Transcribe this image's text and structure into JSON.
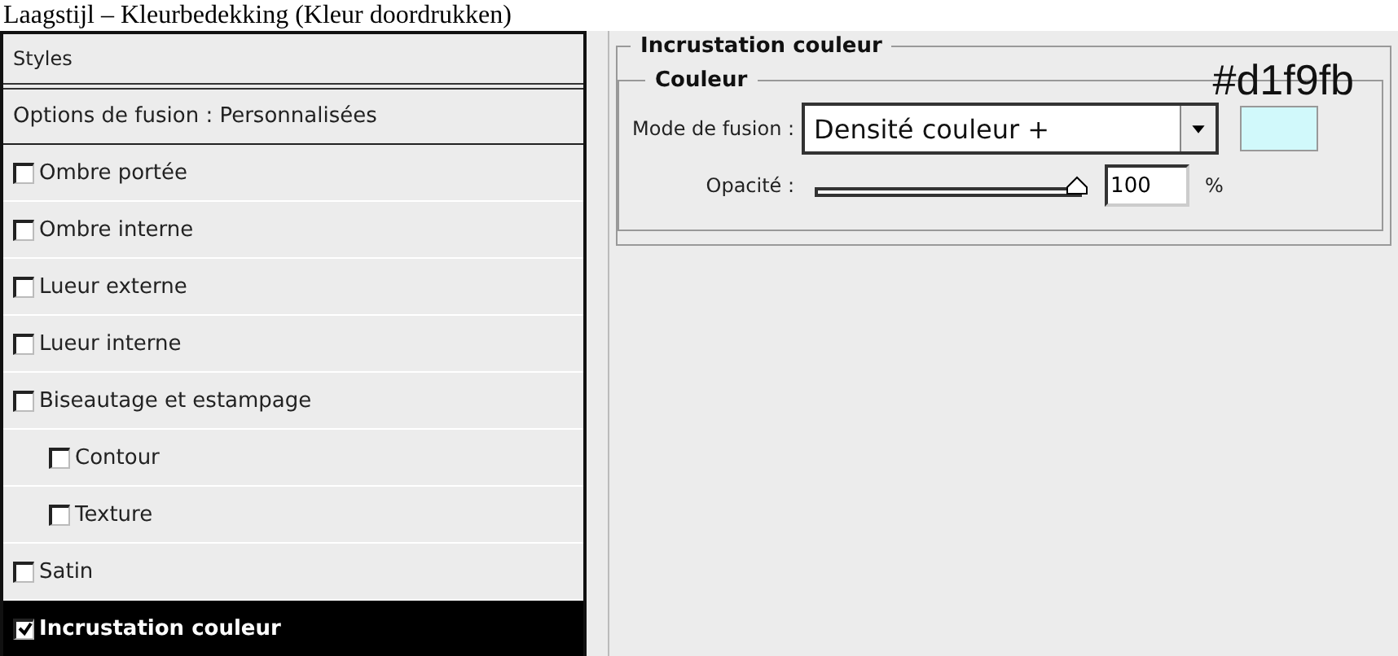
{
  "caption": "Laagstijl – Kleurbedekking (Kleur doordrukken)",
  "sidebar": {
    "title": "Styles",
    "options": "Options de fusion : Personnalisées",
    "items": [
      {
        "label": "Ombre portée",
        "checked": false,
        "selected": false
      },
      {
        "label": "Ombre interne",
        "checked": false,
        "selected": false
      },
      {
        "label": "Lueur externe",
        "checked": false,
        "selected": false
      },
      {
        "label": "Lueur interne",
        "checked": false,
        "selected": false
      },
      {
        "label": "Biseautage et estampage",
        "checked": false,
        "selected": false,
        "children": [
          {
            "label": "Contour",
            "checked": false,
            "selected": false
          },
          {
            "label": "Texture",
            "checked": false,
            "selected": false
          }
        ]
      },
      {
        "label": "Satin",
        "checked": false,
        "selected": false
      },
      {
        "label": "Incrustation couleur",
        "checked": true,
        "selected": true
      }
    ]
  },
  "panel": {
    "title": "Incrustation couleur",
    "color_code": "#d1f9fb",
    "group": {
      "title": "Couleur",
      "blend_label": "Mode de fusion :",
      "blend_value": "Densité couleur +",
      "color": "#d1f9fb",
      "opacity_label": "Opacité :",
      "opacity": {
        "level": 1.0
      },
      "opacity_value": "100",
      "unit": "%"
    }
  }
}
